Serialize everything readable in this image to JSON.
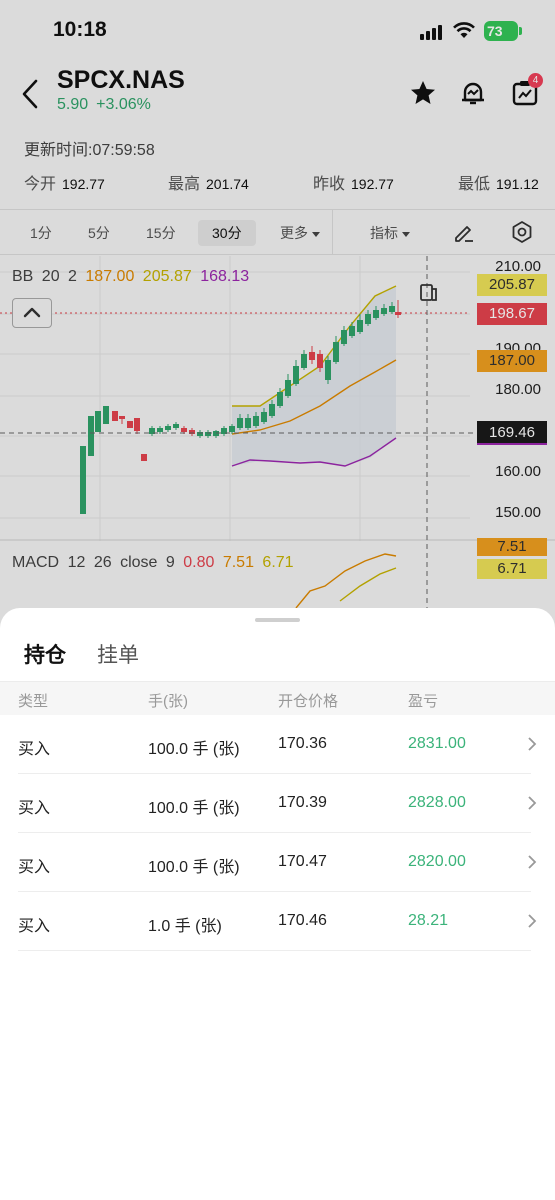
{
  "status_bar": {
    "time": "10:18",
    "battery": "73"
  },
  "header": {
    "symbol": "SPCX.NAS",
    "price": "5.90",
    "change": "+3.06%",
    "notification_count": "4"
  },
  "update_time": "更新时间:07:59:58",
  "quotes": [
    {
      "label": "今开",
      "value": "192.77"
    },
    {
      "label": "最高",
      "value": "201.74"
    },
    {
      "label": "昨收",
      "value": "192.77"
    },
    {
      "label": "最低",
      "value": "191.12"
    }
  ],
  "timeframe_tabs": [
    "1分",
    "5分",
    "15分",
    "30分",
    "更多"
  ],
  "active_timeframe": "30分",
  "indicator_label": "指标",
  "bb_legend": {
    "name": "BB",
    "period": "20",
    "dev": "2",
    "mid": "187.00",
    "upper": "205.87",
    "lower": "168.13"
  },
  "price_axis": [
    "210.00",
    "190.00",
    "180.00",
    "160.00",
    "150.00"
  ],
  "price_tags": {
    "upper": "205.87",
    "last": "198.67",
    "mid": "187.00",
    "cursor": "169.46"
  },
  "macd_legend": {
    "name": "MACD",
    "fast": "12",
    "slow": "26",
    "src": "close",
    "signal": "9",
    "v1": "0.80",
    "v2": "7.51",
    "v3": "6.71"
  },
  "macd_tags": {
    "a": "7.51",
    "b": "6.71"
  },
  "colors": {
    "up": "#2fa36a",
    "down": "#e5434f",
    "mid": "#e08a00",
    "upper": "#c8b400",
    "lower": "#9c27b0"
  },
  "sheet": {
    "tabs": [
      "持仓",
      "挂单"
    ],
    "columns": [
      "类型",
      "手(张)",
      "开仓价格",
      "盈亏"
    ],
    "rows": [
      {
        "type": "买入",
        "qty": "100.0 手 (张)",
        "open_price": "170.36",
        "pnl": "2831.00"
      },
      {
        "type": "买入",
        "qty": "100.0 手 (张)",
        "open_price": "170.39",
        "pnl": "2828.00"
      },
      {
        "type": "买入",
        "qty": "100.0 手 (张)",
        "open_price": "170.47",
        "pnl": "2820.00"
      },
      {
        "type": "买入",
        "qty": "1.0 手 (张)",
        "open_price": "170.46",
        "pnl": "28.21"
      }
    ]
  }
}
